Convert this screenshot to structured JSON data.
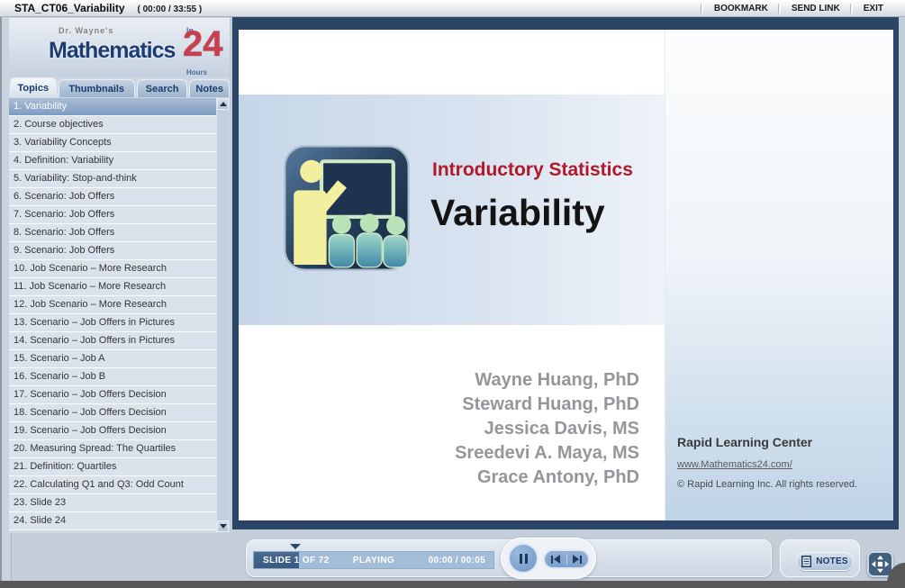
{
  "titlebar": {
    "title": "STA_CT06_Variability",
    "time": "( 00:00 / 33:55 )",
    "actions": [
      "BOOKMARK",
      "SEND LINK",
      "EXIT"
    ]
  },
  "logo": {
    "prefix": "Dr. Wayne's",
    "name": "Mathematics",
    "in_word": "In",
    "number": "24",
    "hours_word": "Hours"
  },
  "sidebar": {
    "tabs": [
      {
        "label": "Topics",
        "active": true
      },
      {
        "label": "Thumbnails",
        "active": false
      },
      {
        "label": "Search",
        "active": false
      },
      {
        "label": "Notes",
        "active": false
      }
    ],
    "topics": {
      "selected_index": 0,
      "items": [
        "1. Variability",
        "2. Course objectives",
        "3. Variability Concepts",
        "4. Definition: Variability",
        "5. Variability: Stop-and-think",
        "6. Scenario: Job Offers",
        "7. Scenario: Job Offers",
        "8. Scenario: Job Offers",
        "9. Scenario: Job Offers",
        "10. Job Scenario – More Research",
        "11. Job Scenario – More Research",
        "12. Job Scenario – More Research",
        "13. Scenario – Job Offers in Pictures",
        "14. Scenario – Job Offers in Pictures",
        "15. Scenario – Job A",
        "16. Scenario – Job B",
        "17. Scenario – Job Offers Decision",
        "18. Scenario – Job Offers Decision",
        "19. Scenario – Job Offers Decision",
        "20. Measuring Spread: The Quartiles",
        "21. Definition: Quartiles",
        "22. Calculating Q1 and Q3: Odd Count",
        "23. Slide 23",
        "24. Slide 24"
      ]
    }
  },
  "slide": {
    "subject": "Introductory Statistics",
    "title": "Variability",
    "authors": [
      "Wayne Huang, PhD",
      "Steward Huang, PhD",
      "Jessica Davis, MS",
      "Sreedevi A. Maya, MS",
      "Grace Antony, PhD"
    ],
    "org": "Rapid Learning Center",
    "website": "www.Mathematics24.com/",
    "copyright": "© Rapid Learning Inc. All rights reserved."
  },
  "playbar": {
    "slide_label": "SLIDE 1 OF 72",
    "status": "PLAYING",
    "time": "00:00 / 00:05",
    "notes_label": "NOTES"
  },
  "icons": {
    "presentation": "teacher-at-board",
    "pause": "pause",
    "step_back": "step-backward",
    "step_forward": "step-forward",
    "notes": "document",
    "fullscreen": "expand-arrows",
    "scroll_up": "triangle-up",
    "scroll_down": "triangle-down",
    "progress_marker": "triangle-down"
  },
  "colors": {
    "stage_navy": "#2a4565",
    "brand_blue": "#1c3c74",
    "brand_red": "#c74050",
    "subject_red": "#b1182a",
    "author_gray": "#949699",
    "band_blue": "#c6d6e9"
  }
}
